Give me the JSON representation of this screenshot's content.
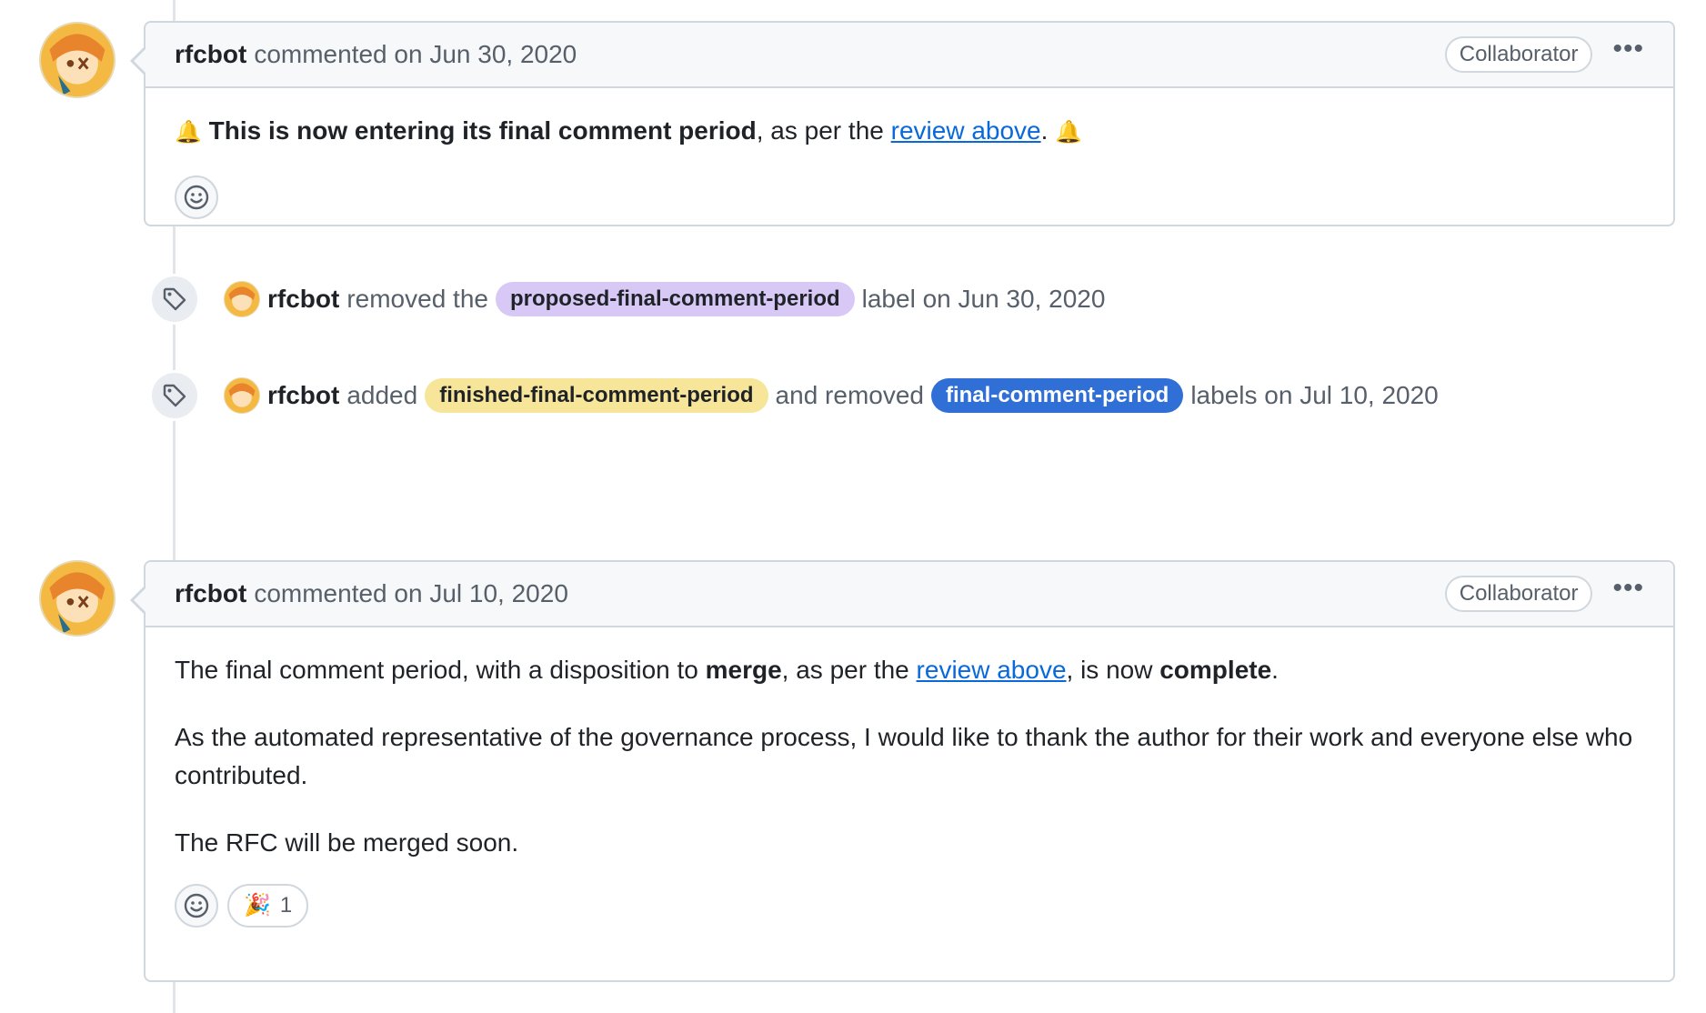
{
  "comments": [
    {
      "author": "rfcbot",
      "action_text": "commented on Jun 30, 2020",
      "role_badge": "Collaborator",
      "menu_label": "•••",
      "body": {
        "emoji_left": "🔔",
        "bold_text": "This is now entering its final comment period",
        "mid_text": ", as per the ",
        "link_text": "review above",
        "end_text": ".",
        "emoji_right": "🔔"
      },
      "reactions": []
    },
    {
      "author": "rfcbot",
      "action_text": "commented on Jul 10, 2020",
      "role_badge": "Collaborator",
      "menu_label": "•••",
      "body": {
        "p1_a": "The final comment period, with a disposition to ",
        "p1_bold1": "merge",
        "p1_b": ", as per the ",
        "p1_link": "review above",
        "p1_c": ", is now ",
        "p1_bold2": "complete",
        "p1_d": ".",
        "p2": "As the automated representative of the governance process, I would like to thank the author for their work and everyone else who contributed.",
        "p3": "The RFC will be merged soon."
      },
      "reactions": [
        {
          "emoji": "🎉",
          "count": "1"
        }
      ]
    }
  ],
  "events": [
    {
      "actor": "rfcbot",
      "text1": "removed the",
      "label": {
        "name": "proposed-final-comment-period",
        "bg": "#d8c8f5",
        "fg": "#1f2328"
      },
      "text2": "label on Jun 30, 2020"
    },
    {
      "actor": "rfcbot",
      "text1": "added",
      "label": {
        "name": "finished-final-comment-period",
        "bg": "#f7e59a",
        "fg": "#1f2328"
      },
      "text2": "and removed",
      "label2": {
        "name": "final-comment-period",
        "bg": "#2f6fd6",
        "fg": "#ffffff"
      },
      "text3": "labels on Jul 10, 2020"
    }
  ],
  "colors": {
    "link": "#0969da",
    "border": "#d0d7de",
    "header_bg": "#f6f8fa"
  }
}
